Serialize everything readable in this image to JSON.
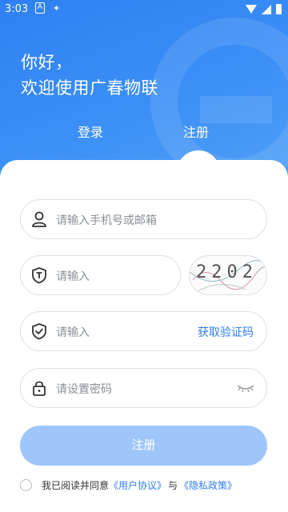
{
  "status_bar": {
    "time": "3:03"
  },
  "greeting": {
    "line1": "你好，",
    "line2": "欢迎使用广春物联"
  },
  "tabs": {
    "login": "登录",
    "register": "注册"
  },
  "form": {
    "phone_placeholder": "请输入手机号或邮箱",
    "captcha_placeholder": "请输入",
    "captcha_image_text": "2202",
    "code_placeholder": "请输入",
    "get_code_label": "获取验证码",
    "password_placeholder": "请设置密码",
    "submit_label": "注册"
  },
  "agreement": {
    "prefix": "我已阅读并同意",
    "user_agreement": "《用户协议》",
    "and": "与",
    "privacy_policy": "《隐私政策》"
  }
}
